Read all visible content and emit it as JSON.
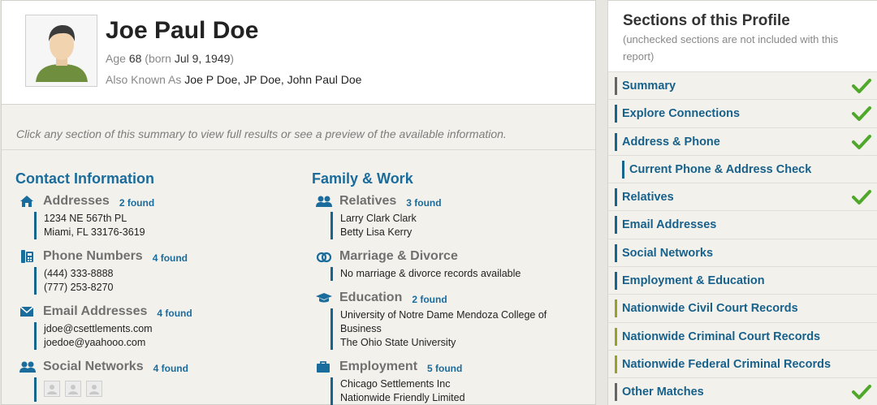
{
  "profile": {
    "name": "Joe Paul Doe",
    "age_label": "Age",
    "age": "68",
    "born_label": "(born",
    "born": "Jul 9, 1949",
    "born_close": ")",
    "aka_label": "Also Known As",
    "aka": "Joe P Doe, JP Doe, John Paul Doe"
  },
  "hint": "Click any section of this summary to view full results or see a preview of the available information.",
  "contact": {
    "title": "Contact Information",
    "addresses": {
      "label": "Addresses",
      "count": "2 found",
      "lines": [
        "1234 NE 567th PL",
        "Miami, FL 33176-3619"
      ]
    },
    "phones": {
      "label": "Phone Numbers",
      "count": "4 found",
      "lines": [
        "(444) 333-8888",
        "(777) 253-8270"
      ]
    },
    "emails": {
      "label": "Email Addresses",
      "count": "4 found",
      "lines": [
        "jdoe@csettlements.com",
        "joedoe@yaahooo.com"
      ]
    },
    "social": {
      "label": "Social Networks",
      "count": "4 found"
    }
  },
  "family": {
    "title": "Family & Work",
    "relatives": {
      "label": "Relatives",
      "count": "3 found",
      "lines": [
        "Larry Clark Clark",
        "Betty Lisa Kerry"
      ]
    },
    "marriage": {
      "label": "Marriage & Divorce",
      "lines": [
        "No marriage & divorce records available"
      ]
    },
    "education": {
      "label": "Education",
      "count": "2 found",
      "lines": [
        "University of Notre Dame Mendoza College of Business",
        "The Ohio State University"
      ]
    },
    "employment": {
      "label": "Employment",
      "count": "5 found",
      "lines": [
        "Chicago Settlements Inc",
        "Nationwide Friendly Limited"
      ]
    }
  },
  "sidebar": {
    "title": "Sections of this Profile",
    "subtitle": "(unchecked sections are not included with this report)",
    "items": [
      {
        "label": "Summary",
        "bar": "#666666",
        "checked": true,
        "sub": false
      },
      {
        "label": "Explore Connections",
        "bar": "#15658f",
        "checked": true,
        "sub": false
      },
      {
        "label": "Address & Phone",
        "bar": "#15658f",
        "checked": true,
        "sub": false
      },
      {
        "label": "Current Phone & Address Check",
        "bar": "#15658f",
        "checked": false,
        "sub": true
      },
      {
        "label": "Relatives",
        "bar": "#15658f",
        "checked": true,
        "sub": false
      },
      {
        "label": "Email Addresses",
        "bar": "#15658f",
        "checked": false,
        "sub": false
      },
      {
        "label": "Social Networks",
        "bar": "#15658f",
        "checked": false,
        "sub": false
      },
      {
        "label": "Employment & Education",
        "bar": "#15658f",
        "checked": false,
        "sub": false
      },
      {
        "label": "Nationwide Civil Court Records",
        "bar": "#9aa02a",
        "checked": false,
        "sub": false
      },
      {
        "label": "Nationwide Criminal Court Records",
        "bar": "#9aa02a",
        "checked": false,
        "sub": false
      },
      {
        "label": "Nationwide Federal Criminal Records",
        "bar": "#9aa02a",
        "checked": false,
        "sub": false
      },
      {
        "label": "Other Matches",
        "bar": "#666666",
        "checked": true,
        "sub": false
      }
    ]
  },
  "colors": {
    "accent": "#1a6c9d",
    "check": "#4fa82a",
    "court": "#9aa02a"
  }
}
